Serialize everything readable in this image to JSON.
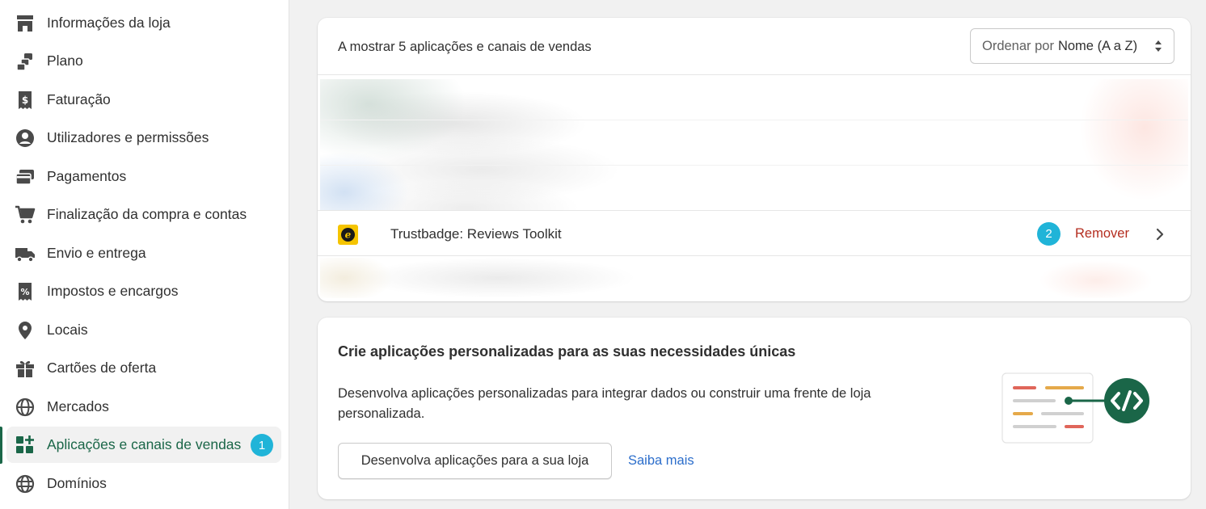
{
  "sidebar": {
    "items": [
      {
        "label": "Informações da loja",
        "icon": "store-icon"
      },
      {
        "label": "Plano",
        "icon": "plan-icon"
      },
      {
        "label": "Faturação",
        "icon": "receipt-dollar-icon"
      },
      {
        "label": "Utilizadores e permissões",
        "icon": "person-icon"
      },
      {
        "label": "Pagamentos",
        "icon": "credit-card-icon"
      },
      {
        "label": "Finalização da compra e contas",
        "icon": "cart-icon"
      },
      {
        "label": "Envio e entrega",
        "icon": "truck-icon"
      },
      {
        "label": "Impostos e encargos",
        "icon": "receipt-percent-icon"
      },
      {
        "label": "Locais",
        "icon": "location-pin-icon"
      },
      {
        "label": "Cartões de oferta",
        "icon": "gift-icon"
      },
      {
        "label": "Mercados",
        "icon": "globe-icon"
      },
      {
        "label": "Aplicações e canais de vendas",
        "icon": "apps-icon",
        "badge": "1",
        "active": true
      },
      {
        "label": "Domínios",
        "icon": "domain-globe-icon"
      }
    ]
  },
  "apps_card": {
    "showing_text": "A mostrar 5 aplicações e canais de vendas",
    "sort": {
      "label": "Ordenar por",
      "value": "Nome (A a Z)"
    },
    "app_row": {
      "name": "Trustbadge: Reviews Toolkit",
      "badge": "2",
      "remove_label": "Remover"
    }
  },
  "custom_card": {
    "title": "Crie aplicações personalizadas para as suas necessidades únicas",
    "description": "Desenvolva aplicações personalizadas para integrar dados ou construir uma frente de loja personalizada.",
    "primary_button": "Desenvolva aplicações para a sua loja",
    "link": "Saiba mais"
  },
  "colors": {
    "accent": "#1a6648",
    "badge": "#20b4d8",
    "danger": "#b42d1f",
    "link": "#2c6ecb"
  }
}
